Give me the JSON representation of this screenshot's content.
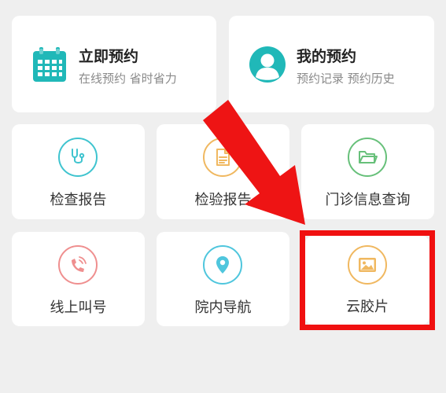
{
  "top_cards": {
    "book_now": {
      "title": "立即预约",
      "subtitle": "在线预约 省时省力",
      "icon": "calendar-icon"
    },
    "my_appointments": {
      "title": "我的预约",
      "subtitle": "预约记录 预约历史",
      "icon": "user-avatar-icon"
    }
  },
  "tiles": {
    "exam_report": {
      "label": "检查报告",
      "icon": "stethoscope-icon"
    },
    "lab_report": {
      "label": "检验报告",
      "icon": "document-icon"
    },
    "outpatient_query": {
      "label": "门诊信息查询",
      "icon": "folder-icon"
    },
    "online_queue": {
      "label": "线上叫号",
      "icon": "phone-icon"
    },
    "navigation": {
      "label": "院内导航",
      "icon": "location-pin-icon"
    },
    "cloud_film": {
      "label": "云胶片",
      "icon": "image-icon"
    }
  },
  "colors": {
    "accent_teal": "#20b8b8",
    "annotation_red": "#f01010"
  }
}
